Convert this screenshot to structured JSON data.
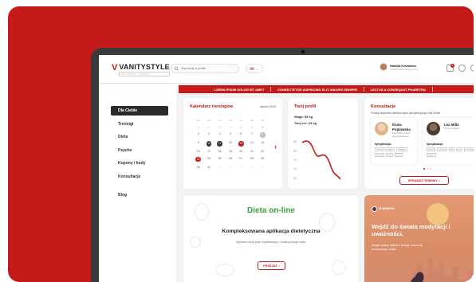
{
  "brand": {
    "name": "VANITYSTYLE",
    "tagline": "STYL ŻYCIA · ACTIVE"
  },
  "search": {
    "placeholder": "Wyszukaj w profilu",
    "icon": "search-icon"
  },
  "language": {
    "code": "PL",
    "icon": "chevron-down-icon"
  },
  "user": {
    "name": "Natalia Kowalska",
    "email": "natalia.kowalska@gmail.pl",
    "notifications": "2"
  },
  "ticker": [
    "LOREM IPSUM DOLOR SIT AMET",
    "CONSECTETUR ADIPISCING ELIT. MAURIS SEMPER",
    "LECTUS A CONSEQUAT PHARETRA"
  ],
  "sidebar": {
    "collapse_icon": "chevron-left-icon",
    "items": [
      {
        "label": "Dla Ciebie",
        "active": true
      },
      {
        "label": "Treningi"
      },
      {
        "label": "Dieta"
      },
      {
        "label": "Psyche"
      },
      {
        "label": "Kupony i kody"
      },
      {
        "label": "Konsultacje"
      }
    ],
    "blog": "Blog"
  },
  "calendar": {
    "title": "Kalendarz treningów",
    "month": "styczeń 2023",
    "weekdays": [
      "pn",
      "wt",
      "śr",
      "cz",
      "pt",
      "sb",
      "nd"
    ],
    "rows": [
      [
        "26",
        "27",
        "28",
        "29",
        "30",
        "31",
        "1"
      ],
      [
        "2",
        "3",
        "4",
        "5",
        "6",
        "7",
        "8"
      ],
      [
        "9",
        "10",
        "11",
        "12",
        "13",
        "14",
        "15"
      ],
      [
        "16",
        "17",
        "18",
        "19",
        "20",
        "21",
        "22"
      ],
      [
        "23",
        "24",
        "25",
        "26",
        "27",
        "28",
        "29"
      ],
      [
        "30",
        "31",
        "1",
        "2",
        "3",
        "4",
        "5"
      ]
    ],
    "next_icon": "chevron-right-icon"
  },
  "profile": {
    "title": "Twój profil",
    "weight": "Waga: 85 kg",
    "goal": "Twój cel: 65 kg",
    "y_ticks": [
      "85",
      "80",
      "75",
      "70",
      "65"
    ],
    "accent": "#c41a1a"
  },
  "consult": {
    "title": "Konsultacje",
    "subtitle": "Poznaj ekspertów dietetycznych specjalizujących dla Ciebie",
    "experts": [
      {
        "name1": "Kasia",
        "name2": "Popławska",
        "role": "Psycholog, coach, psychoterapeuta",
        "spec": "Specjalizacja:",
        "tags": [
          "zaburzenia odżywiania",
          "motywacja",
          "depresja",
          "stres",
          "relacje"
        ]
      },
      {
        "name1": "Lea Milla",
        "name2": "",
        "role": "Trener osobisty",
        "spec": "Specjalizacja:",
        "tags": [
          "zdrowie",
          "nadwaga",
          "siła",
          "dieta",
          "rehabilitacja",
          "bieganie"
        ]
      }
    ],
    "button": "SPRAWDŹ TERMINY"
  },
  "diet": {
    "title": "Dieta on-line",
    "headline": "Kompleksowana aplikacja dietetyczna",
    "sub": "Wybierz swój plan żywieniowy i realizuj swoje cele.",
    "button": "PRZEJDŹ",
    "accent": "#3ea33e"
  },
  "meditate": {
    "logo": "ॐ MINDFUL",
    "title": "Wejdź do świata medytacji i uważności.",
    "sub": "Znajdź spokój, zadbaj o emocje, wzmocnij koncentrację i relaks."
  }
}
